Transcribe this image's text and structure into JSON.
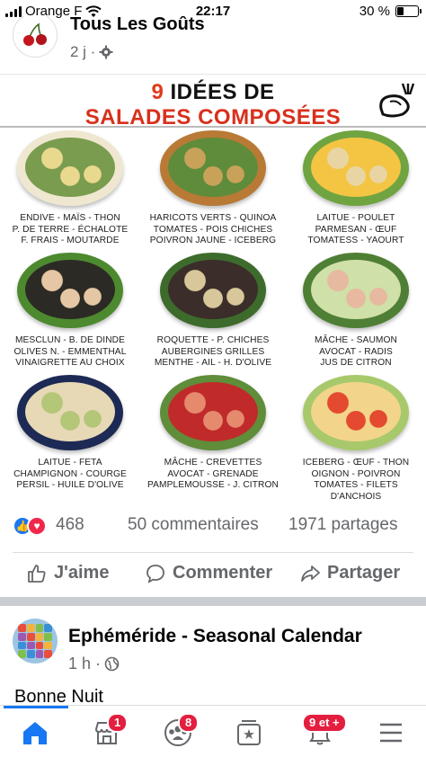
{
  "status_bar": {
    "carrier": "Orange F",
    "time": "22:17",
    "battery": "30 %",
    "battery_level": 0.3
  },
  "post": {
    "page_name": "Tous Les Goûts",
    "time_ago": "2 j ·",
    "image": {
      "title_number": "9",
      "title_line1": "IDÉES DE",
      "title_line2": "SALADES COMPOSÉES",
      "salads": [
        {
          "lines": [
            "ENDIVE - MAÏS - THON",
            "P. DE TERRE - ÉCHALOTE",
            "F. FRAIS - MOUTARDE"
          ],
          "colors": [
            "#efe7d0",
            "#e9d98f",
            "#7a9c4e"
          ]
        },
        {
          "lines": [
            "HARICOTS VERTS - QUINOA",
            "TOMATES - POIS CHICHES",
            "POIVRON JAUNE - ICEBERG"
          ],
          "colors": [
            "#b87a35",
            "#c9a25a",
            "#5f8c3a"
          ]
        },
        {
          "lines": [
            "LAITUE - POULET",
            "PARMESAN - ŒUF",
            "TOMATESS - YAOURT"
          ],
          "colors": [
            "#6fa441",
            "#e9d5a4",
            "#f3c543"
          ]
        },
        {
          "lines": [
            "MESCLUN - B. DE DINDE",
            "OLIVES N. - EMMENTHAL",
            "VINAIGRETTE AU CHOIX"
          ],
          "colors": [
            "#4d8a2f",
            "#e5c7a5",
            "#2c2a24"
          ]
        },
        {
          "lines": [
            "ROQUETTE - P. CHICHES",
            "AUBERGINES GRILLES",
            "MENTHE - AIL - H. D'OLIVE"
          ],
          "colors": [
            "#3d6b2c",
            "#d8c79a",
            "#3a2d2a"
          ]
        },
        {
          "lines": [
            "MÂCHE - SAUMON",
            "AVOCAT - RADIS",
            "JUS DE CITRON"
          ],
          "colors": [
            "#4f7f35",
            "#e7b9a0",
            "#cfe0a8"
          ]
        },
        {
          "lines": [
            "LAITUE - FETA",
            "CHAMPIGNON - COURGE",
            "PERSIL - HUILE D'OLIVE"
          ],
          "colors": [
            "#1d2a55",
            "#b4c678",
            "#e7d9b6"
          ]
        },
        {
          "lines": [
            "MÂCHE - CREVETTES",
            "AVOCAT - GRENADE",
            "PAMPLEMOUSSE - J. CITRON"
          ],
          "colors": [
            "#5f8d3a",
            "#e68a6e",
            "#c02a2a"
          ]
        },
        {
          "lines": [
            "ICEBERG - ŒUF - THON",
            "OIGNON - POIVRON",
            "TOMATES - FILETS D'ANCHOIS"
          ],
          "colors": [
            "#a7c96b",
            "#e34a2f",
            "#f2d58a"
          ]
        }
      ]
    },
    "reaction_count": "468",
    "comments": "50 commentaires",
    "shares": "1971 partages",
    "actions": {
      "like": "J'aime",
      "comment": "Commenter",
      "share": "Partager"
    }
  },
  "post2": {
    "page_name": "Ephéméride - Seasonal Calendar",
    "time_ago": "1 h ·",
    "text": "Bonne Nuit"
  },
  "bottom_nav": {
    "badges": {
      "marketplace": "1",
      "groups": "8",
      "notifications": "9 et +"
    }
  }
}
